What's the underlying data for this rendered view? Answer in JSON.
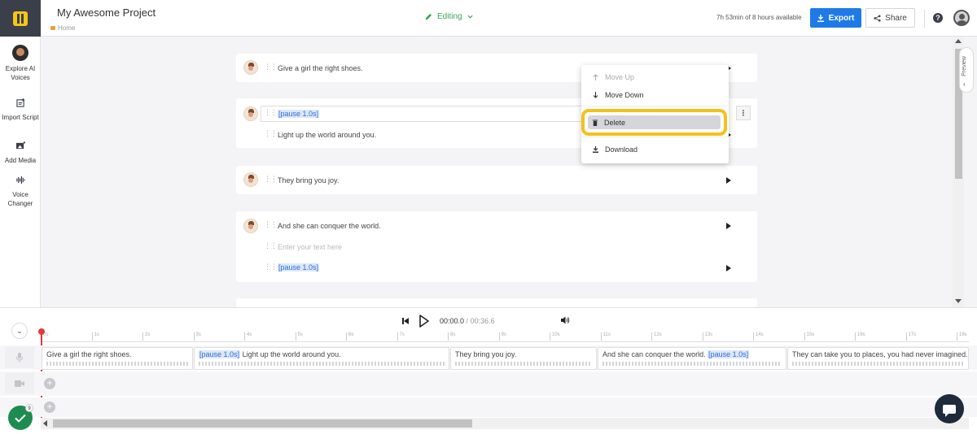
{
  "header": {
    "project_title": "My Awesome Project",
    "breadcrumb": "Home",
    "mode": "Editing",
    "quota": "7h 53min of 8 hours available",
    "export_label": "Export",
    "share_label": "Share",
    "help": "?"
  },
  "sidebar": {
    "items": [
      {
        "label": "Explore AI Voices",
        "icon": "avatar"
      },
      {
        "label": "Import Script",
        "icon": "import-icon"
      },
      {
        "label": "Add Media",
        "icon": "media-icon"
      },
      {
        "label": "Voice Changer",
        "icon": "voice-changer-icon"
      }
    ]
  },
  "blocks": [
    {
      "lines": [
        "Give a girl the right shoes."
      ]
    },
    {
      "lines": [
        "[pause 1.0s]",
        "Light up the world around you."
      ]
    },
    {
      "lines": [
        "They bring you joy."
      ]
    },
    {
      "lines": [
        "And she can conquer the world.",
        "Enter your text here",
        "[pause 1.0s]"
      ]
    }
  ],
  "context_menu": {
    "move_up": "Move Up",
    "move_down": "Move Down",
    "delete": "Delete",
    "download": "Download"
  },
  "preview_label": "Preview",
  "player": {
    "current_time": "00:00.0",
    "separator": "/",
    "total_time": "00:36.6"
  },
  "ruler_ticks": [
    "0s",
    "1s",
    "2s",
    "3s",
    "4s",
    "5s",
    "6s",
    "7s",
    "8s",
    "9s",
    "10s",
    "11s",
    "12s",
    "13s",
    "14s",
    "15s",
    "16s",
    "17s",
    "18s"
  ],
  "clips": [
    {
      "text": "Give a girl the right shoes.",
      "pause": ""
    },
    {
      "text": "Light up the world around you.",
      "pause": "[pause 1.0s]"
    },
    {
      "text": "They bring you joy.",
      "pause": ""
    },
    {
      "text": "And she can conquer the world.",
      "pause": "[pause 1.0s]"
    },
    {
      "text": "They can take you to places, you had never imagined.",
      "pause": ""
    }
  ],
  "status_badge_count": "9",
  "colors": {
    "accent": "#1e7ae6",
    "editing_green": "#3aa655",
    "highlight_yellow": "#f2c21b",
    "playhead_red": "#e53935"
  }
}
